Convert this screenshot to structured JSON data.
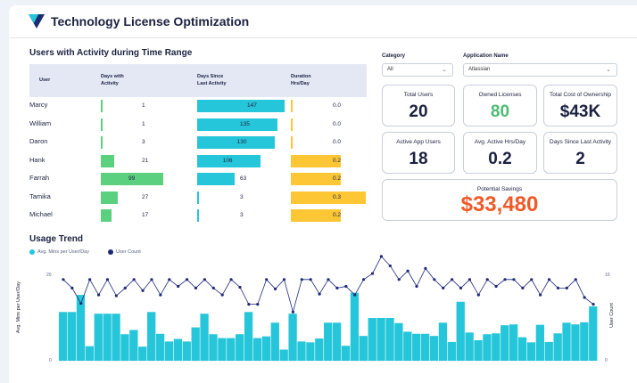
{
  "app": {
    "title": "Technology License Optimization"
  },
  "activity": {
    "title": "Users with Activity during Time Range",
    "columns": {
      "user": "User",
      "days_with": "Days with\nActivity",
      "days_since": "Days Since\nLast Activity",
      "duration": "Duration\nHrs/Day"
    },
    "rows": [
      {
        "name": "Marcy",
        "days_with": 1,
        "days_since": 147,
        "duration": "0.0"
      },
      {
        "name": "William",
        "days_with": 1,
        "days_since": 135,
        "duration": "0.0"
      },
      {
        "name": "Daron",
        "days_with": 3,
        "days_since": 130,
        "duration": "0.0"
      },
      {
        "name": "Hank",
        "days_with": 21,
        "days_since": 106,
        "duration": "0.2"
      },
      {
        "name": "Farrah",
        "days_with": 99,
        "days_since": 63,
        "duration": "0.2"
      },
      {
        "name": "Tamika",
        "days_with": 27,
        "days_since": 3,
        "duration": "0.3"
      },
      {
        "name": "Michael",
        "days_with": 17,
        "days_since": 3,
        "duration": "0.2"
      }
    ],
    "colors": {
      "days_with": "#5bd07e",
      "days_since": "#26c6da",
      "duration": "#fcc635"
    }
  },
  "filters": {
    "category": {
      "label": "Category",
      "value": "All"
    },
    "application": {
      "label": "Application Name",
      "value": "Atlassian"
    }
  },
  "kpis": {
    "total_users": {
      "label": "Total Users",
      "value": "20"
    },
    "owned_licenses": {
      "label": "Owned Licenses",
      "value": "80"
    },
    "total_cost": {
      "label": "Total Cost of Ownership",
      "value": "$43K"
    },
    "active_app_users": {
      "label": "Active App Users",
      "value": "18"
    },
    "avg_active_hrs": {
      "label": "Avg. Active Hrs/Day",
      "value": "0.2"
    },
    "days_since_last": {
      "label": "Days Since Last Activity",
      "value": "2"
    },
    "potential_savings": {
      "label": "Potential Savings",
      "value": "$33,480"
    }
  },
  "colors": {
    "accent_green": "#4dbb72",
    "accent_orange": "#f05a28",
    "bar_teal": "#26c6da",
    "line_navy": "#1e2a78"
  },
  "usage_trend": {
    "title": "Usage Trend",
    "legend": {
      "mins": "Avg. Mins per User/Day",
      "users": "User Count"
    },
    "left_axis_title": "Avg. Mins per User/Day",
    "right_axis_title": "User Count",
    "left_ticks": [
      "20",
      "0"
    ],
    "right_ticks": [
      "10",
      "0"
    ]
  },
  "chart_data": {
    "type": "bar",
    "title": "",
    "ylabel": "Avg. Mins per User/Day",
    "y2label": "User Count",
    "ylim": [
      0,
      20
    ],
    "y2lim": [
      0,
      10
    ],
    "series": [
      {
        "name": "Avg. Mins per User/Day",
        "type": "bar",
        "values": [
          11.4,
          11.4,
          15.4,
          3.4,
          11,
          11,
          11,
          6.2,
          7.2,
          3.3,
          11.4,
          6.3,
          4.5,
          5.1,
          4.5,
          7.8,
          11,
          6.2,
          5.3,
          5.3,
          6.2,
          11.4,
          5.3,
          5.7,
          8.9,
          2.6,
          11,
          4.5,
          4.3,
          5.2,
          8.9,
          8.9,
          3.5,
          15.9,
          5.8,
          10,
          10,
          10,
          8.8,
          6.8,
          6.3,
          6.3,
          5.8,
          8.9,
          4.4,
          13.8,
          6.6,
          4.8,
          6.2,
          6.4,
          8.3,
          8.5,
          5.5,
          4.3,
          8.4,
          4.4,
          6.4,
          8.9,
          8.5,
          9,
          12.7
        ]
      },
      {
        "name": "User Count",
        "type": "line",
        "values": [
          9.5,
          8.5,
          6.7,
          9.5,
          7.7,
          9.5,
          7.6,
          8.5,
          9.5,
          8.2,
          9.5,
          7.7,
          9.5,
          8.7,
          9.5,
          8.5,
          9.5,
          8.5,
          7.7,
          9.5,
          8.6,
          6.6,
          6.6,
          9.5,
          8.4,
          9.5,
          5.7,
          9.5,
          9.5,
          7.8,
          9.5,
          8.5,
          8.7,
          7.7,
          9.5,
          10.2,
          12.2,
          11.1,
          9.5,
          10.5,
          8.7,
          10.8,
          9.5,
          8.5,
          9.5,
          8.5,
          9.5,
          7.7,
          9.5,
          8.7,
          9.5,
          9.5,
          8.5,
          9.5,
          7.7,
          9.5,
          8.5,
          8.5,
          9.5,
          7.4,
          6.6
        ]
      }
    ]
  }
}
